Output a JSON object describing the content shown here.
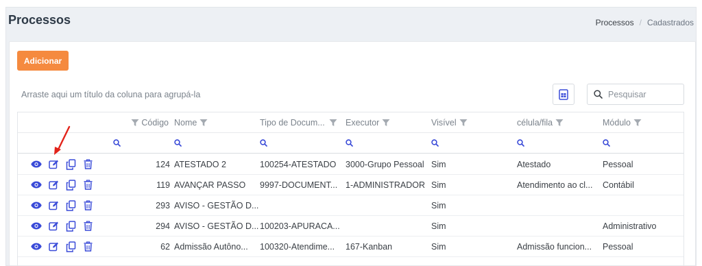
{
  "header": {
    "title": "Processos",
    "breadcrumb": [
      "Processos",
      "Cadastrados"
    ]
  },
  "toolbar": {
    "add_label": "Adicionar",
    "group_hint": "Arraste aqui um título da coluna para agrupá-la",
    "search_placeholder": "Pesquisar"
  },
  "table": {
    "columns": [
      "Código",
      "Nome",
      "Tipo de Docum...",
      "Executor",
      "Visível",
      "célula/fila",
      "Módulo"
    ],
    "rows": [
      {
        "codigo": "124",
        "nome": "ATESTADO 2",
        "tipo": "100254-ATESTADO",
        "executor": "3000-Grupo Pessoal",
        "visivel": "Sim",
        "celula": "Atestado",
        "modulo": "Pessoal"
      },
      {
        "codigo": "119",
        "nome": "AVANÇAR PASSO",
        "tipo": "9997-DOCUMENT...",
        "executor": "1-ADMINISTRADOR",
        "visivel": "Sim",
        "celula": "Atendimento ao cl...",
        "modulo": "Contábil"
      },
      {
        "codigo": "293",
        "nome": "AVISO - GESTÃO D...",
        "tipo": "",
        "executor": "",
        "visivel": "Sim",
        "celula": "",
        "modulo": ""
      },
      {
        "codigo": "294",
        "nome": "AVISO - GESTÃO D...",
        "tipo": "100203-APURACA...",
        "executor": "",
        "visivel": "Sim",
        "celula": "",
        "modulo": "Administrativo"
      },
      {
        "codigo": "62",
        "nome": "Admissão Autôno...",
        "tipo": "100320-Atendime...",
        "executor": "167-Kanban",
        "visivel": "Sim",
        "celula": "Admissão funcion...",
        "modulo": "Pessoal"
      }
    ]
  },
  "icons": {
    "row_actions": [
      "eye-icon",
      "edit-icon",
      "copy-icon",
      "trash-icon"
    ],
    "filter": "funnel-icon",
    "search": "search-icon",
    "export": "excel-export-icon",
    "annotation": "red-arrow-icon"
  },
  "colors": {
    "accent": "#f58a3f",
    "primary": "#3a4bd8",
    "annotation": "#e2231a"
  }
}
